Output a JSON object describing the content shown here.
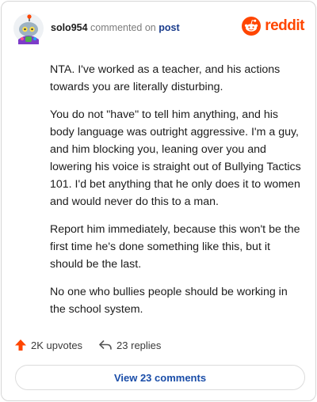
{
  "comment": {
    "username": "solo954",
    "action": "commented on",
    "target": "post"
  },
  "brand": {
    "name": "reddit",
    "color": "#ff4500"
  },
  "body": [
    "NTA. I've worked as a teacher, and his actions towards you are literally disturbing.",
    "You do not \"have\" to tell him anything, and his body language was outright aggressive. I'm a guy, and him blocking you, leaning over you and lowering his voice is straight out of Bullying Tactics 101. I'd bet anything that he only does it to women and would never do this to a man.",
    "Report him immediately, because this won't be the first time he's done something like this, but it should be the last.",
    "No one who bullies people should be working in the school system."
  ],
  "stats": {
    "upvotes": "2K upvotes",
    "replies": "23 replies"
  },
  "footer": {
    "view_comments": "View 23 comments"
  },
  "icons": {
    "upvote": "upvote-arrow-icon",
    "reply": "reply-arrow-icon",
    "avatar": "snoo-avatar-icon",
    "logo": "reddit-alien-icon"
  }
}
